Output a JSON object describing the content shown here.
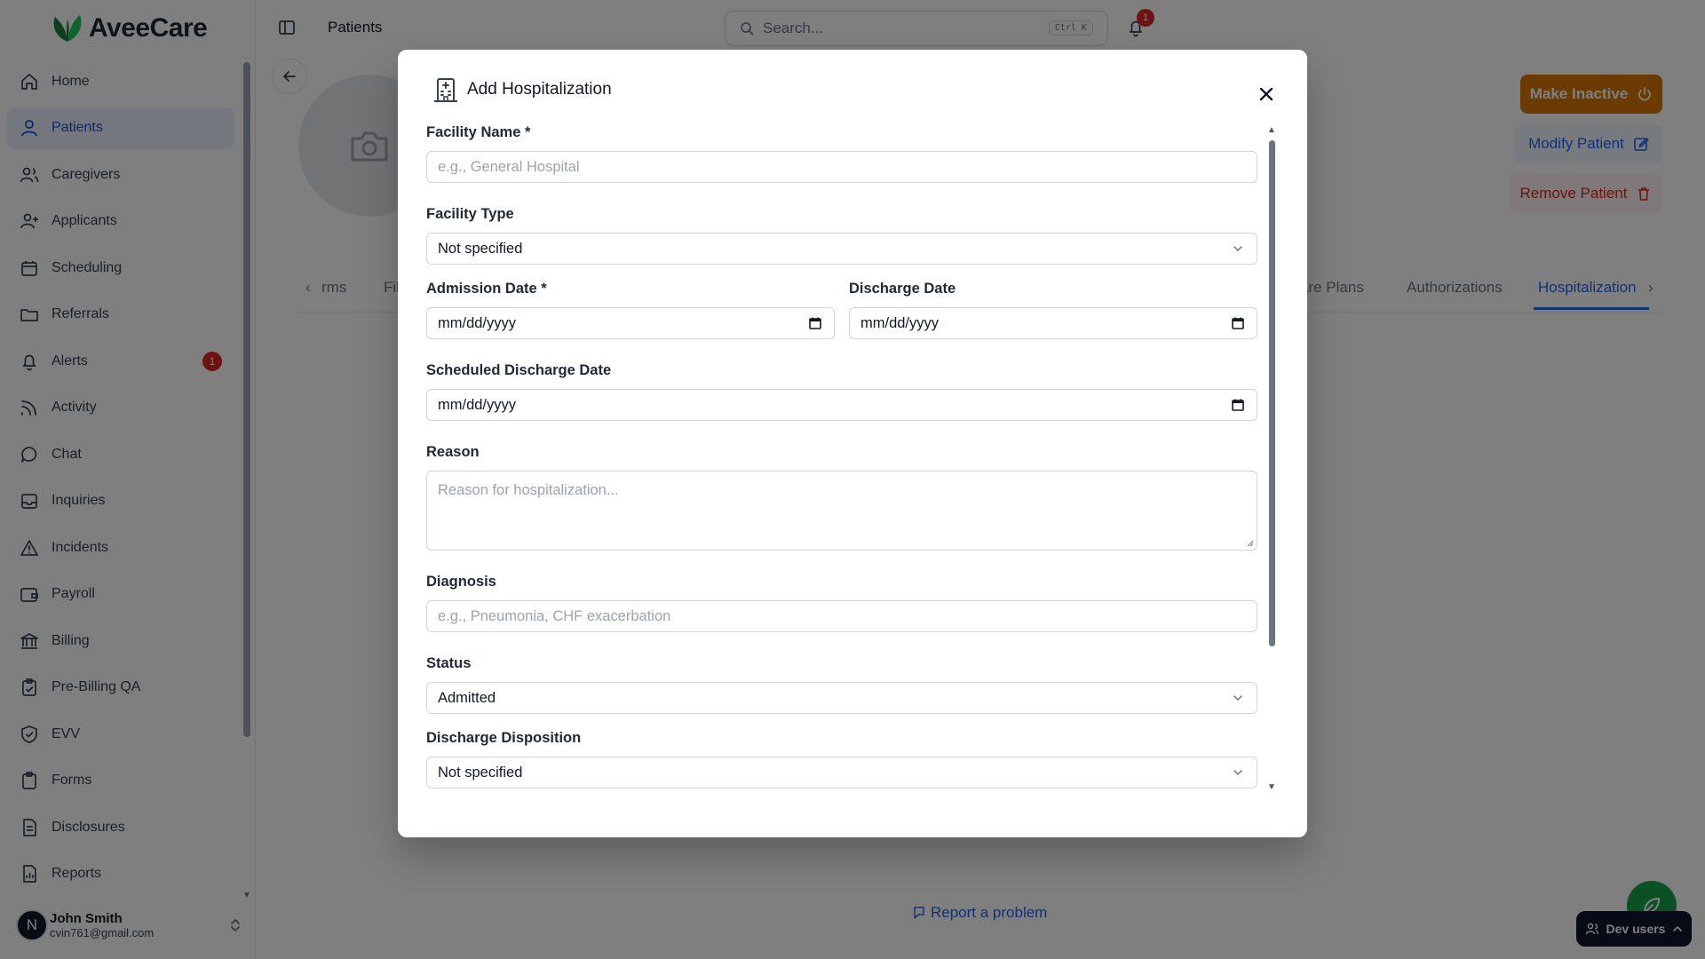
{
  "app": {
    "name": "AveeCare"
  },
  "sidebar": {
    "items": [
      {
        "label": "Home",
        "icon": "home-icon"
      },
      {
        "label": "Patients",
        "icon": "user-icon",
        "active": true
      },
      {
        "label": "Caregivers",
        "icon": "users-icon"
      },
      {
        "label": "Applicants",
        "icon": "user-plus-icon"
      },
      {
        "label": "Scheduling",
        "icon": "calendar-icon"
      },
      {
        "label": "Referrals",
        "icon": "folder-icon"
      },
      {
        "label": "Alerts",
        "icon": "bell-icon",
        "badge": "1"
      },
      {
        "label": "Activity",
        "icon": "activity-icon"
      },
      {
        "label": "Chat",
        "icon": "chat-icon"
      },
      {
        "label": "Inquiries",
        "icon": "inbox-icon"
      },
      {
        "label": "Incidents",
        "icon": "warning-icon"
      },
      {
        "label": "Payroll",
        "icon": "wallet-icon"
      },
      {
        "label": "Billing",
        "icon": "bank-icon"
      },
      {
        "label": "Pre-Billing QA",
        "icon": "clipboard-check-icon"
      },
      {
        "label": "EVV",
        "icon": "shield-check-icon"
      },
      {
        "label": "Forms",
        "icon": "clipboard-icon"
      },
      {
        "label": "Disclosures",
        "icon": "document-icon"
      },
      {
        "label": "Reports",
        "icon": "report-icon"
      }
    ],
    "user": {
      "initial": "N",
      "name": "John Smith",
      "email": "cvin761@gmail.com"
    }
  },
  "header": {
    "title": "Patients",
    "search_placeholder": "Search...",
    "search_shortcut": "Ctrl K",
    "notification_count": "1"
  },
  "page": {
    "buttons": {
      "make_inactive": "Make Inactive",
      "modify_patient": "Modify Patient",
      "remove_patient": "Remove Patient"
    },
    "tabs": [
      "rms",
      "Fil",
      "are Plans",
      "Authorizations",
      "Hospitalization"
    ],
    "active_tab": "Hospitalization",
    "report_problem": "Report a problem",
    "dev_users": "Dev users"
  },
  "modal": {
    "title": "Add Hospitalization",
    "fields": {
      "facility_name": {
        "label": "Facility Name *",
        "placeholder": "e.g., General Hospital"
      },
      "facility_type": {
        "label": "Facility Type",
        "value": "Not specified"
      },
      "admission_date": {
        "label": "Admission Date *",
        "value": "mm/dd/yyyy"
      },
      "discharge_date": {
        "label": "Discharge Date",
        "value": "mm/dd/yyyy"
      },
      "scheduled_discharge_date": {
        "label": "Scheduled Discharge Date",
        "value": "mm/dd/yyyy"
      },
      "reason": {
        "label": "Reason",
        "placeholder": "Reason for hospitalization..."
      },
      "diagnosis": {
        "label": "Diagnosis",
        "placeholder": "e.g., Pneumonia, CHF exacerbation"
      },
      "status": {
        "label": "Status",
        "value": "Admitted"
      },
      "discharge_disposition": {
        "label": "Discharge Disposition",
        "value": "Not specified"
      }
    }
  },
  "colors": {
    "brand_green": "#16a34a",
    "primary_blue": "#2563eb",
    "warning_amber": "#d97706",
    "danger_red": "#dc2626"
  }
}
